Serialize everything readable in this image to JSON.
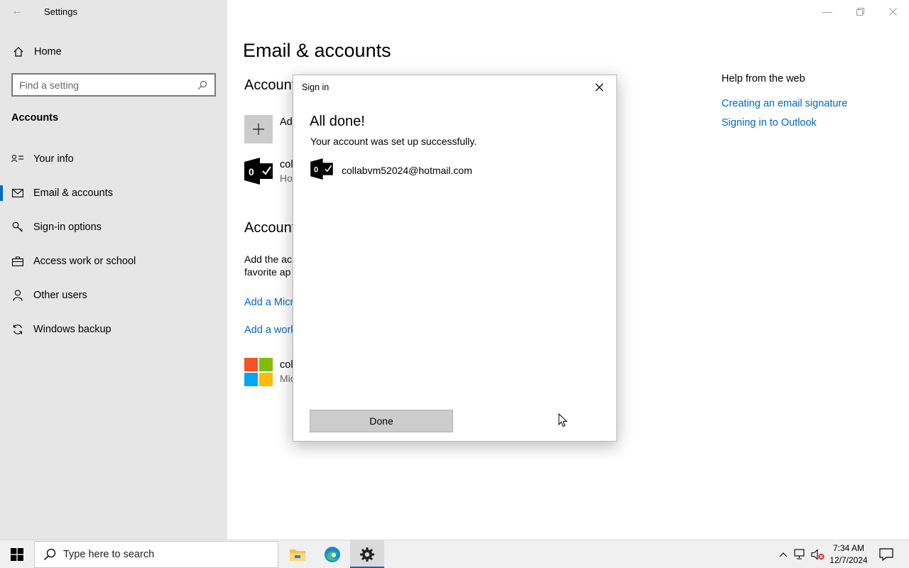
{
  "app": {
    "title": "Settings"
  },
  "sidebar": {
    "home_label": "Home",
    "search_placeholder": "Find a setting",
    "section_title": "Accounts",
    "items": [
      {
        "label": "Your info",
        "icon": "person-card-icon"
      },
      {
        "label": "Email & accounts",
        "icon": "mail-icon",
        "active": true
      },
      {
        "label": "Sign-in options",
        "icon": "key-icon"
      },
      {
        "label": "Access work or school",
        "icon": "briefcase-icon"
      },
      {
        "label": "Other users",
        "icon": "person-icon"
      },
      {
        "label": "Windows backup",
        "icon": "sync-icon"
      }
    ]
  },
  "main": {
    "page_title": "Email & accounts",
    "accounts_used_heading": "Account",
    "add_account_label": "Ad",
    "outlook_account_name": "col",
    "outlook_account_sub": "Ho",
    "other_apps_heading": "Account",
    "other_apps_para_line1": "Add the ac",
    "other_apps_para_line2": "favorite ap",
    "add_ms_account_link": "Add a Micr",
    "add_work_account_link": "Add a work",
    "ms_account_name": "col",
    "ms_account_sub": "Mic"
  },
  "help": {
    "title": "Help from the web",
    "links": [
      "Creating an email signature",
      "Signing in to Outlook"
    ]
  },
  "dialog": {
    "title": "Sign in",
    "heading": "All done!",
    "message": "Your account was set up successfully.",
    "email": "collabvm52024@hotmail.com",
    "done_label": "Done"
  },
  "taskbar": {
    "search_placeholder": "Type here to search",
    "time": "7:34 AM",
    "date": "12/7/2024"
  },
  "colors": {
    "accent": "#0067c0",
    "sidebar_bg": "#e6e6e6",
    "button_bg": "#cccccc"
  }
}
